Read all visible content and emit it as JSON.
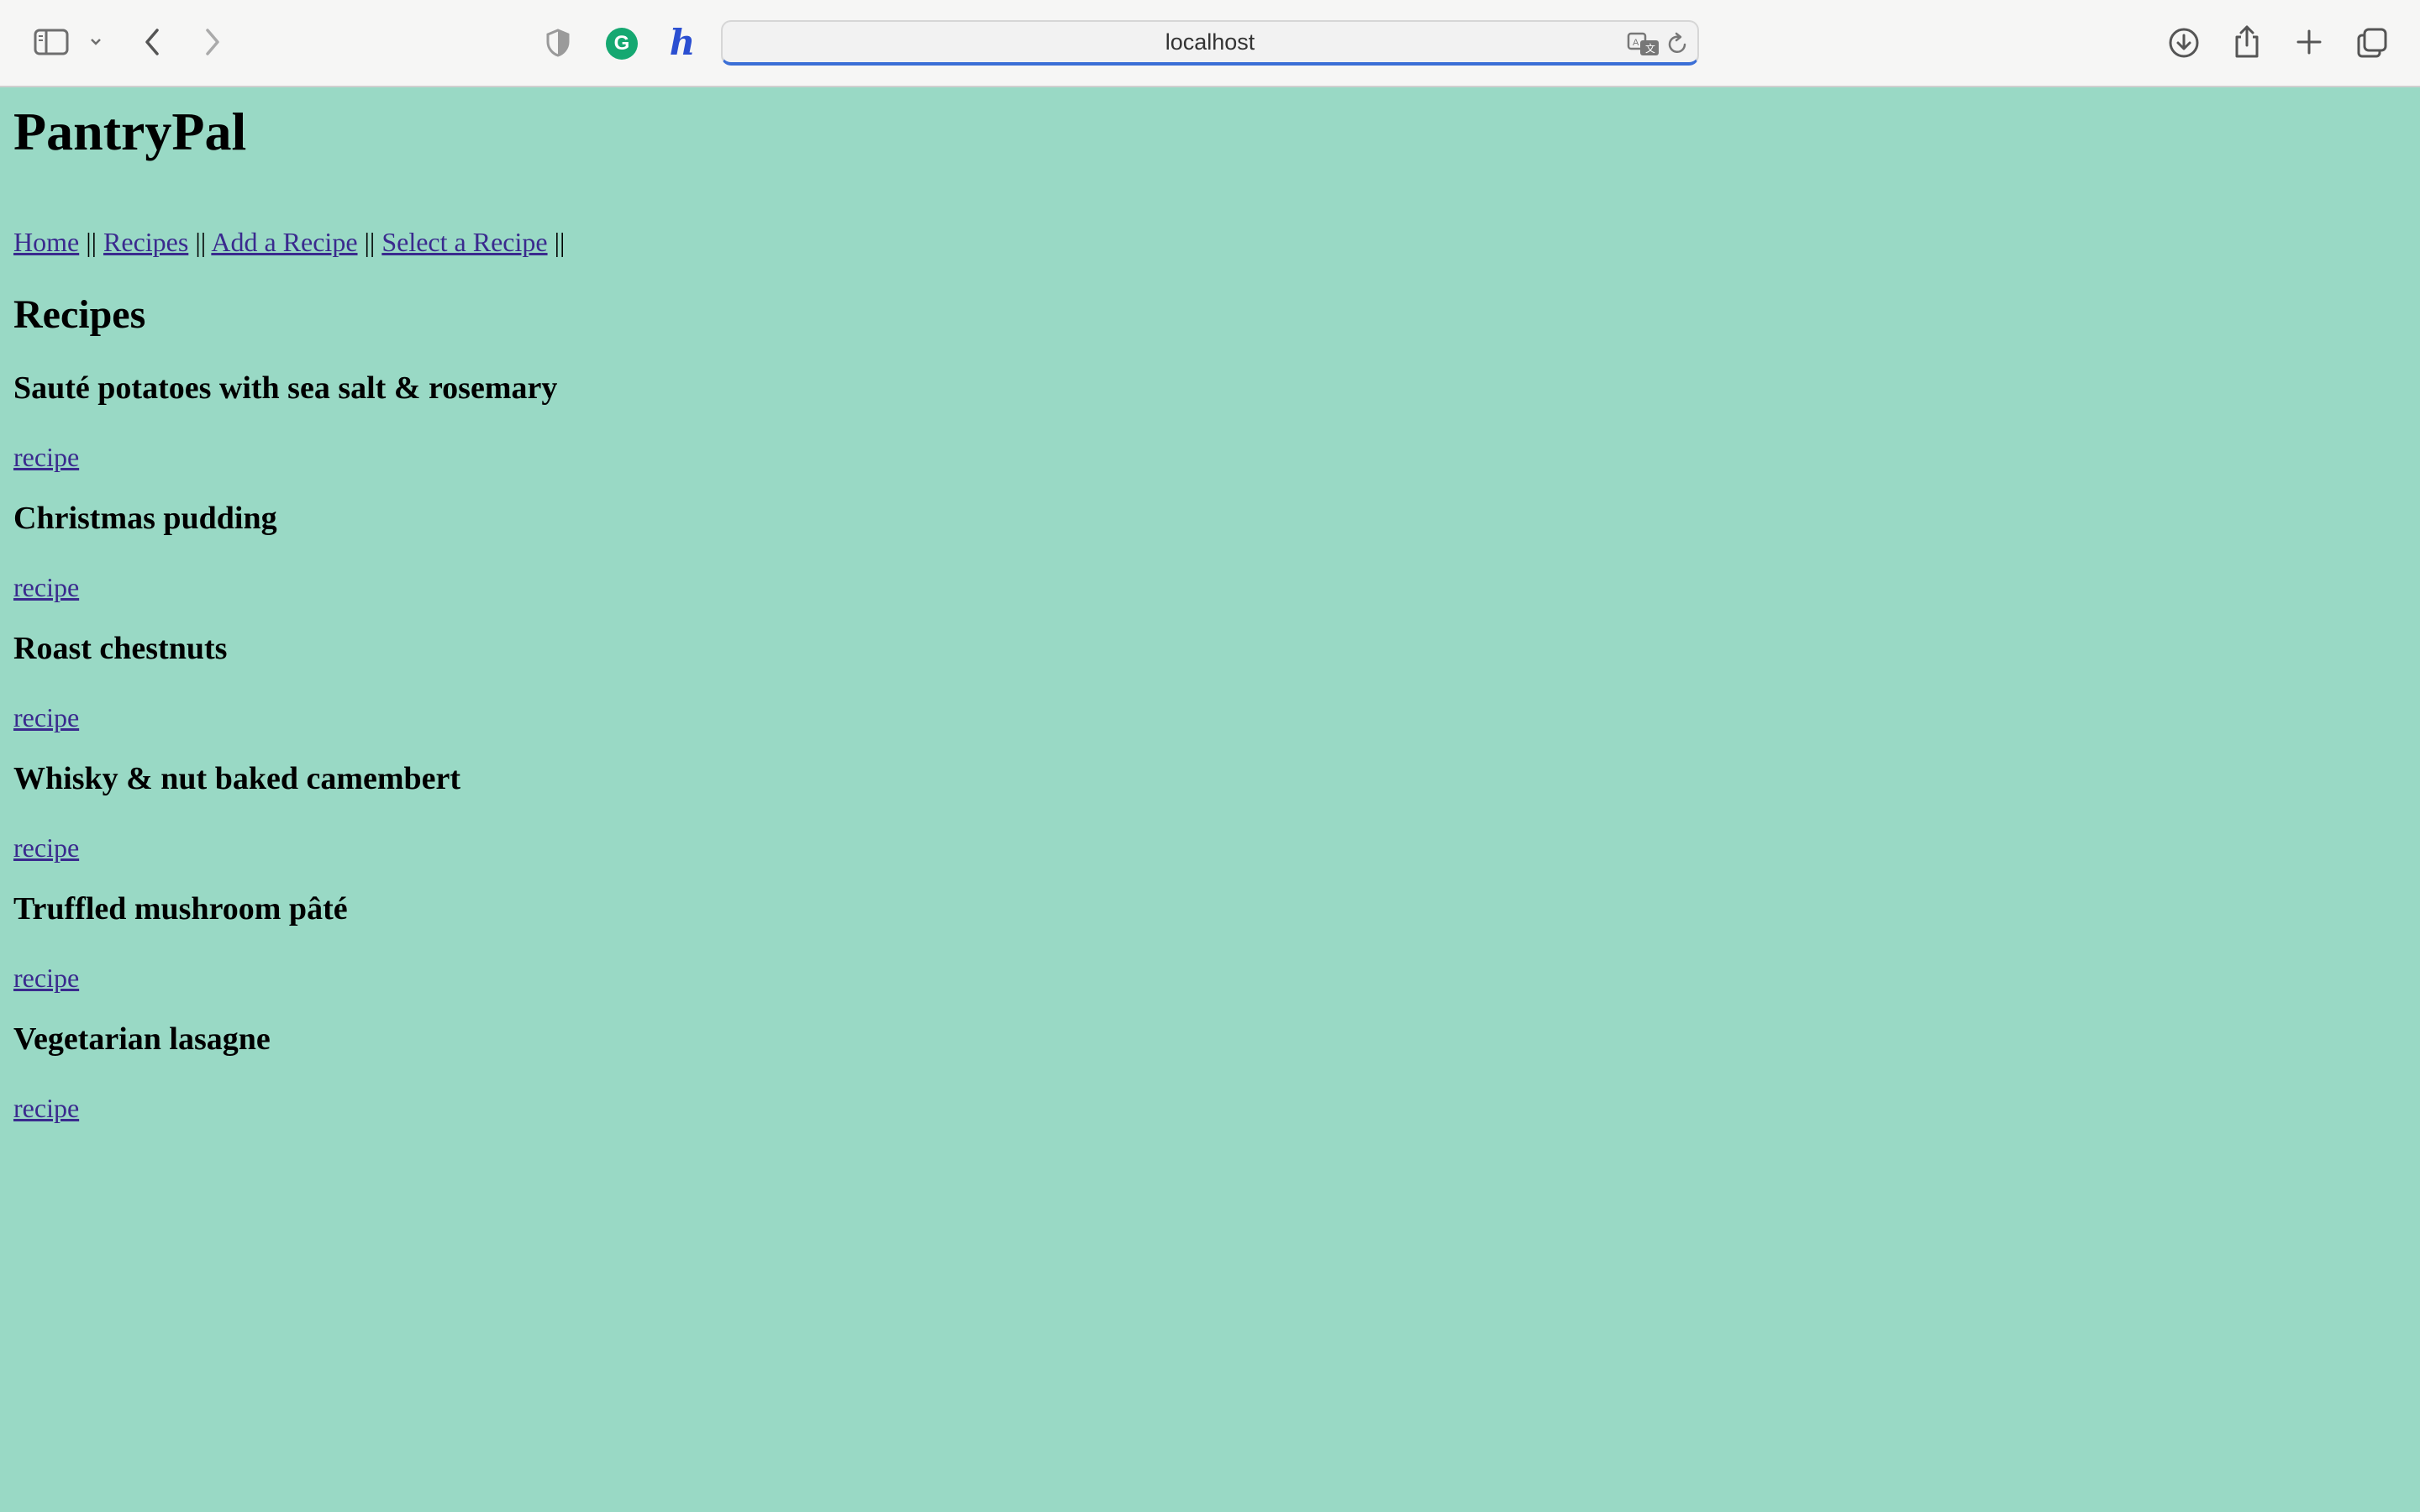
{
  "browser": {
    "url": "localhost",
    "icons": [
      "sidebar-icon",
      "chevron-down-icon",
      "back-icon",
      "forward-icon",
      "shield-icon",
      "grammarly-icon",
      "honey-icon",
      "translate-icon",
      "reload-icon",
      "download-icon",
      "share-icon",
      "plus-icon",
      "tabs-icon"
    ],
    "grammarly_glyph": "G",
    "honey_glyph": "h",
    "accent_color": "#3b6fd6"
  },
  "site": {
    "title": "PantryPal",
    "background_color": "#99d9c5"
  },
  "nav": {
    "items": [
      {
        "label": "Home"
      },
      {
        "label": "Recipes"
      },
      {
        "label": "Add a Recipe"
      },
      {
        "label": "Select a Recipe"
      }
    ],
    "separator": "||"
  },
  "main": {
    "heading": "Recipes",
    "recipes": [
      {
        "name": "Sauté potatoes with sea salt & rosemary",
        "link": "recipe"
      },
      {
        "name": "Christmas pudding",
        "link": "recipe"
      },
      {
        "name": "Roast chestnuts",
        "link": "recipe"
      },
      {
        "name": "Whisky & nut baked camembert",
        "link": "recipe"
      },
      {
        "name": "Truffled mushroom pâté",
        "link": "recipe"
      },
      {
        "name": "Vegetarian lasagne",
        "link": "recipe"
      }
    ]
  }
}
